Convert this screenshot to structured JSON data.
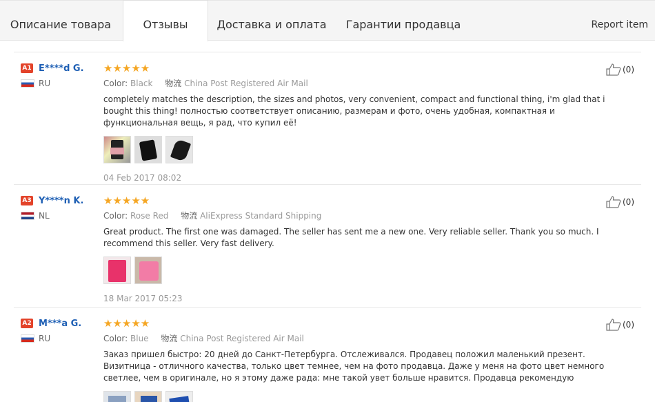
{
  "tabs": [
    {
      "label": "Описание товара"
    },
    {
      "label": "Отзывы"
    },
    {
      "label": "Доставка и оплата"
    },
    {
      "label": "Гарантии продавца"
    }
  ],
  "report_label": "Report item",
  "reviews": [
    {
      "level": "A1",
      "name": "E****d G.",
      "country": "RU",
      "stars": "★★★★★",
      "color_label": "Color:",
      "color": "Black",
      "ship_label": "物流",
      "shipping": "China Post Registered Air Mail",
      "text": "completely matches the description, the sizes and photos, very convenient, compact and functional thing, i'm glad that i bought this thing! полностью соответствует описанию, размерам и фото, очень удобная, компактная и функциональная вещь, я рад, что купил её!",
      "date": "04 Feb 2017 08:02",
      "likes": "(0)"
    },
    {
      "level": "A3",
      "name": "Y****n K.",
      "country": "NL",
      "stars": "★★★★★",
      "color_label": "Color:",
      "color": "Rose Red",
      "ship_label": "物流",
      "shipping": "AliExpress Standard Shipping",
      "text": "Great product. The first one was damaged. The seller has sent me a new one. Very reliable seller. Thank you so much. I recommend this seller. Very fast delivery.",
      "date": "18 Mar 2017 05:23",
      "likes": "(0)"
    },
    {
      "level": "A2",
      "name": "M***a G.",
      "country": "RU",
      "stars": "★★★★★",
      "color_label": "Color:",
      "color": "Blue",
      "ship_label": "物流",
      "shipping": "China Post Registered Air Mail",
      "text": "Заказ пришел быстро: 20 дней до Санкт-Петербурга. Отслеживался. Продавец положил маленький презент. Визитница - отличного качества, только цвет темнее, чем на фото продавца. Даже у меня на фото цвет немного светлее, чем в оригинале, но я этому даже рада: мне такой увет больше нравится. Продавца рекомендую",
      "date": "",
      "likes": "(0)"
    }
  ]
}
